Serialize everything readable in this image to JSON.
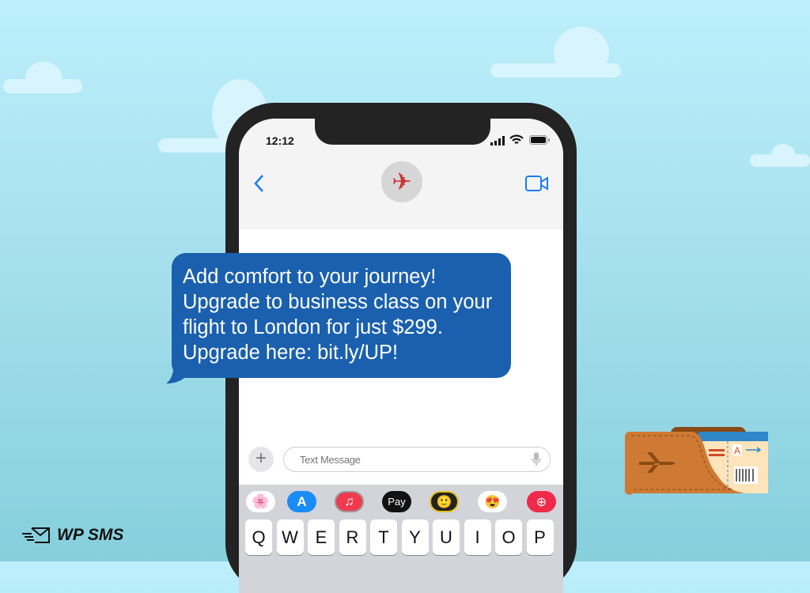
{
  "status_bar": {
    "time": "12:12"
  },
  "header": {
    "contact_icon": "airplane-icon",
    "back_icon": "chevron-left-icon",
    "video_icon": "video-camera-icon"
  },
  "message": {
    "text": "Add comfort to your journey! Upgrade to business class on your flight to London for just $299. Upgrade here: bit.ly/UP!",
    "color": "#1a60ae"
  },
  "composer": {
    "placeholder": "Text Message",
    "value": ""
  },
  "apps": [
    {
      "name": "photos"
    },
    {
      "name": "app-store"
    },
    {
      "name": "music"
    },
    {
      "name": "apple-pay",
      "label": "Pay"
    },
    {
      "name": "memoji"
    },
    {
      "name": "memoji-stickers"
    },
    {
      "name": "web-search"
    }
  ],
  "keyboard": {
    "row1": [
      "Q",
      "W",
      "E",
      "R",
      "T",
      "Y",
      "U",
      "I",
      "O",
      "P"
    ]
  },
  "brand": {
    "name": "WP SMS"
  },
  "ticket": {
    "seat_letter": "A"
  }
}
